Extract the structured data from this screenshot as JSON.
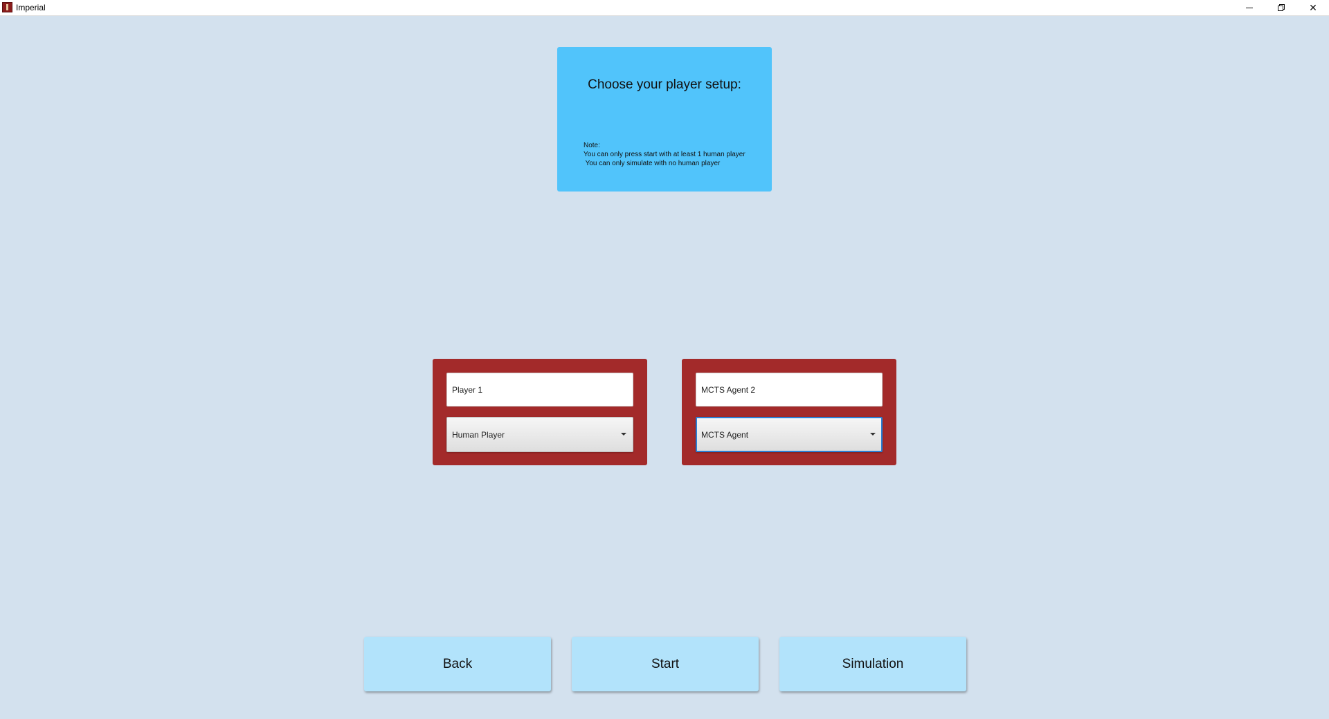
{
  "window": {
    "title": "Imperial",
    "minimize_glyph": "",
    "close_glyph": "✕"
  },
  "note_panel": {
    "title": "Choose your player setup:",
    "lines": [
      "Note:",
      "You can only press start with at least 1 human player",
      " You can only simulate with no human player"
    ]
  },
  "players": [
    {
      "name": "Player 1",
      "type": "Human Player"
    },
    {
      "name": "MCTS Agent 2",
      "type": "MCTS Agent"
    }
  ],
  "buttons": {
    "back": "Back",
    "start": "Start",
    "simulation": "Simulation"
  },
  "colors": {
    "background": "#d3e1ee",
    "note_panel": "#51c4fb",
    "player_card": "#a32a2a",
    "button": "#b2e3fb",
    "focus": "#2a7fd4"
  }
}
